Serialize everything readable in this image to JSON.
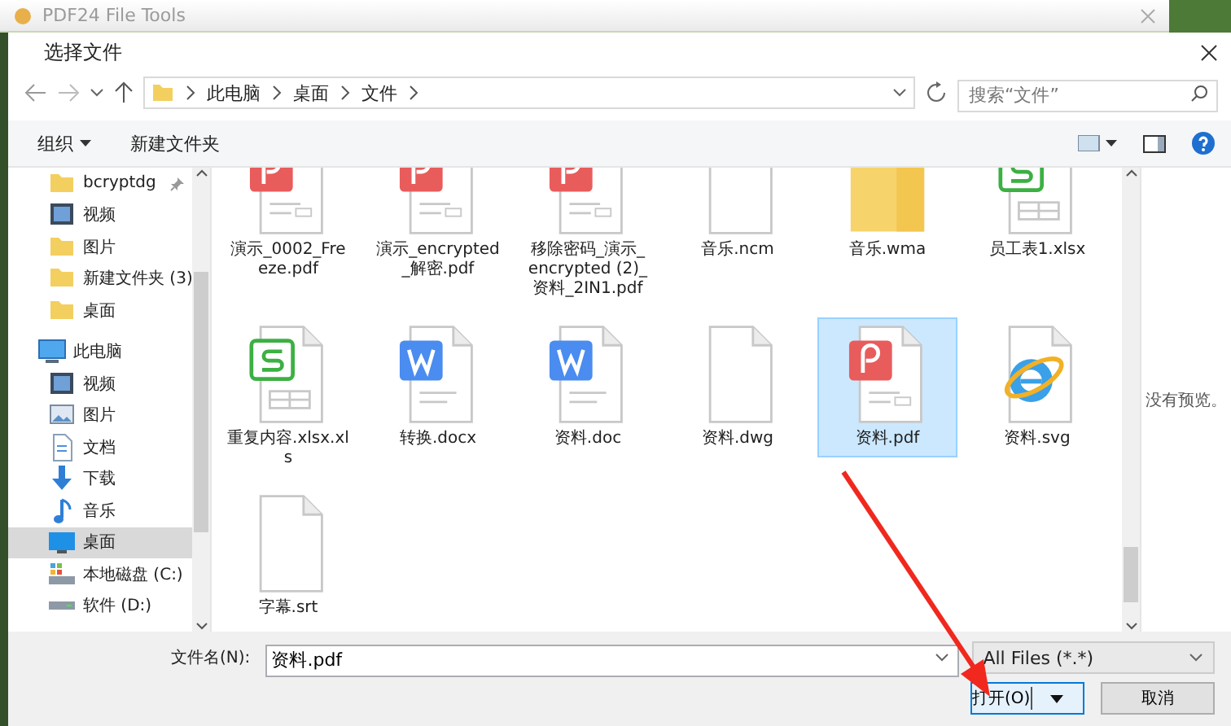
{
  "background_window": {
    "title": "PDF24 File Tools"
  },
  "dialog": {
    "title": "选择文件"
  },
  "address_bar": {
    "path": [
      "此电脑",
      "桌面",
      "文件"
    ]
  },
  "search": {
    "placeholder": "搜索“文件”"
  },
  "toolbar": {
    "organize": "组织",
    "new_folder": "新建文件夹"
  },
  "sidebar": {
    "quick_access": [
      {
        "label": "bcryptdg",
        "kind": "folder",
        "pinned": true,
        "selected": false
      },
      {
        "label": "视频",
        "kind": "video",
        "pinned": false,
        "selected": false
      },
      {
        "label": "图片",
        "kind": "folder",
        "pinned": false,
        "selected": false
      },
      {
        "label": "新建文件夹 (3)",
        "kind": "folder",
        "pinned": false,
        "selected": false
      },
      {
        "label": "桌面",
        "kind": "folder",
        "pinned": false,
        "selected": false
      }
    ],
    "tree": [
      {
        "label": "此电脑",
        "kind": "pc",
        "selected": false,
        "children": [
          {
            "label": "视频",
            "kind": "video",
            "selected": false
          },
          {
            "label": "图片",
            "kind": "picture",
            "selected": false
          },
          {
            "label": "文档",
            "kind": "document",
            "selected": false
          },
          {
            "label": "下载",
            "kind": "download",
            "selected": false
          },
          {
            "label": "音乐",
            "kind": "music",
            "selected": false
          },
          {
            "label": "桌面",
            "kind": "desktop",
            "selected": true
          },
          {
            "label": "本地磁盘 (C:)",
            "kind": "system-drive",
            "selected": false
          },
          {
            "label": "软件 (D:)",
            "kind": "drive",
            "selected": false
          }
        ]
      }
    ]
  },
  "files": [
    {
      "name": "演示_0002_Freeze.pdf",
      "kind": "pdf",
      "selected": false
    },
    {
      "name": "演示_encrypted_解密.pdf",
      "kind": "pdf",
      "selected": false
    },
    {
      "name": "移除密码_演示_encrypted (2)_资料_2IN1.pdf",
      "kind": "pdf",
      "selected": false
    },
    {
      "name": "音乐.ncm",
      "kind": "blank",
      "selected": false
    },
    {
      "name": "音乐.wma",
      "kind": "media",
      "selected": false
    },
    {
      "name": "员工表1.xlsx",
      "kind": "sheet",
      "selected": false
    },
    {
      "name": "重复内容.xlsx.xls",
      "kind": "sheet",
      "selected": false
    },
    {
      "name": "转换.docx",
      "kind": "word",
      "selected": false
    },
    {
      "name": "资料.doc",
      "kind": "word",
      "selected": false
    },
    {
      "name": "资料.dwg",
      "kind": "blank",
      "selected": false
    },
    {
      "name": "资料.pdf",
      "kind": "pdf",
      "selected": true
    },
    {
      "name": "资料.svg",
      "kind": "browser",
      "selected": false
    },
    {
      "name": "字幕.srt",
      "kind": "blank",
      "selected": false
    }
  ],
  "preview": {
    "text": "没有预览。"
  },
  "file_name": {
    "label": "文件名(N):",
    "value": "资料.pdf"
  },
  "file_type": {
    "value": "All Files (*.*)"
  },
  "buttons": {
    "open": "打开(O)",
    "cancel": "取消"
  }
}
